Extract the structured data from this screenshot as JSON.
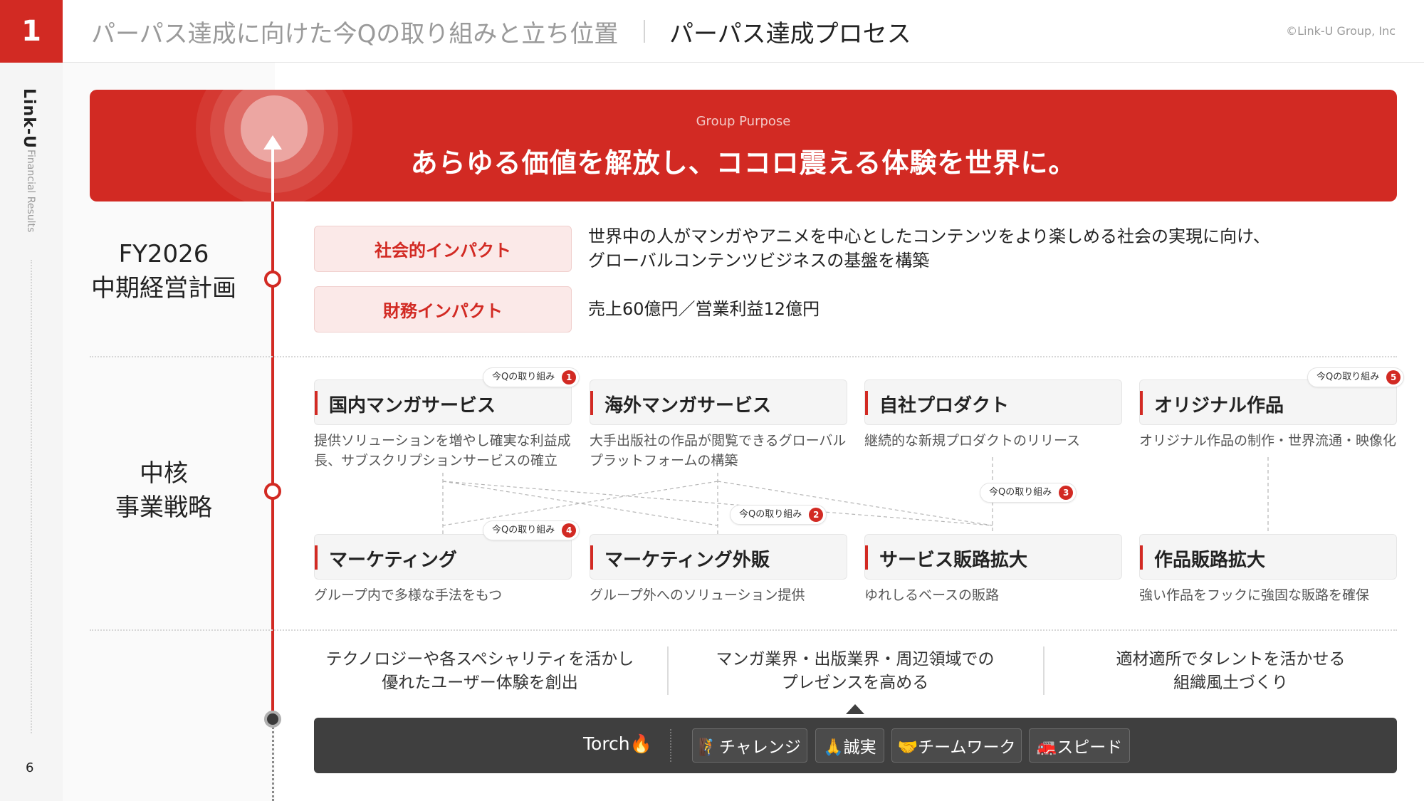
{
  "header": {
    "section_number": "1",
    "title_context": "パーパス達成に向けた今Qの取り組みと立ち位置",
    "title_main": "パーパス達成プロセス",
    "copyright": "©Link-U Group, Inc"
  },
  "sidebar": {
    "brand": "Link-U",
    "subtitle": "Financial Results",
    "page_number": "6"
  },
  "purpose": {
    "eyebrow": "Group Purpose",
    "statement": "あらゆる価値を解放し、ココロ震える体験を世界に。"
  },
  "midterm_plan": {
    "label_line1": "FY2026",
    "label_line2": "中期経営計画",
    "social_impact": {
      "label": "社会的インパクト",
      "text_line1": "世界中の人がマンガやアニメを中心としたコンテンツをより楽しめる社会の実現に向け、",
      "text_line2": "グローバルコンテンツビジネスの基盤を構築"
    },
    "financial_impact": {
      "label": "財務インパクト",
      "text": "売上60億円／営業利益12億円"
    }
  },
  "core_strategy": {
    "label_line1": "中核",
    "label_line2": "事業戦略",
    "badge_text": "今Qの取り組み",
    "top_row": [
      {
        "title": "国内マンガサービス",
        "desc_line1": "提供ソリューションを増やし確実な利益成",
        "desc_line2": "長、サブスクリプションサービスの確立",
        "badge_num": "1"
      },
      {
        "title": "海外マンガサービス",
        "desc_line1": "大手出版社の作品が閲覧できるグローバル",
        "desc_line2": "プラットフォームの構築",
        "badge_num": ""
      },
      {
        "title": "自社プロダクト",
        "desc_line1": "継続的な新規プロダクトのリリース",
        "desc_line2": "",
        "badge_num": ""
      },
      {
        "title": "オリジナル作品",
        "desc_line1": "オリジナル作品の制作・世界流通・映像化",
        "desc_line2": "",
        "badge_num": "5"
      }
    ],
    "bottom_row": [
      {
        "title": "マーケティング",
        "desc": "グループ内で多様な手法をもつ",
        "badge_num": "4"
      },
      {
        "title": "マーケティング外販",
        "desc": "グループ外へのソリューション提供",
        "badge_num": "2"
      },
      {
        "title": "サービス販路拡大",
        "desc": "ゆれしるベースの販路",
        "badge_num": "3"
      },
      {
        "title": "作品販路拡大",
        "desc": "強い作品をフックに強固な販路を確保",
        "badge_num": ""
      }
    ]
  },
  "values": [
    {
      "line1": "テクノロジーや各スペシャリティを活かし",
      "line2": "優れたユーザー体験を創出"
    },
    {
      "line1": "マンガ業界・出版業界・周辺領域での",
      "line2": "プレゼンスを高める"
    },
    {
      "line1": "適材適所でタレントを活かせる",
      "line2": "組織風土づくり"
    }
  ],
  "torch": {
    "label": "Torch🔥",
    "chips": [
      "🧗チャレンジ",
      "🙏誠実",
      "🤝チームワーク",
      "🚒スピード"
    ]
  },
  "colors": {
    "brand_red": "#d22a23",
    "impact_bg": "#fbe9e8",
    "torch_bg": "#3f3f3f"
  }
}
